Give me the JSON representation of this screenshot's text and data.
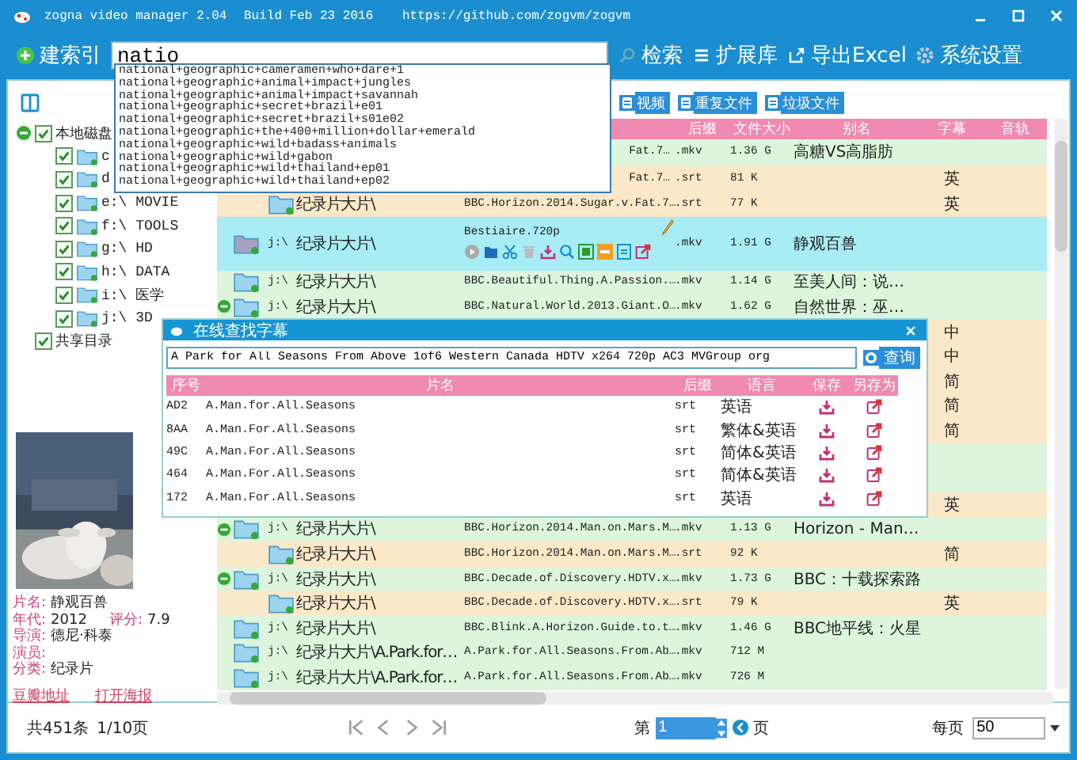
{
  "window": {
    "title": "zogna video manager 2.04",
    "build": "Build Feb 23 2016",
    "url": "https://github.com/zogvm/zogvm"
  },
  "toolbar": {
    "index_button": "建索引",
    "search": {
      "value": "natio"
    },
    "search_button": "检索",
    "library_button": "扩展库",
    "export_button": "导出Excel",
    "settings_button": "系统设置"
  },
  "suggestions": [
    "national+geographic+cameramen+who+dare+1",
    "national+geographic+animal+impact+jungles",
    "national+geographic+animal+impact+savannah",
    "national+geographic+secret+brazil+e01",
    "national+geographic+secret+brazil+s01e02",
    "national+geographic+the+400+million+dollar+emerald",
    "national+geographic+wild+badass+animals",
    "national+geographic+wild+gabon",
    "national+geographic+wild+thailand+ep01",
    "national+geographic+wild+thailand+ep02"
  ],
  "tree": [
    {
      "label": "本地磁盘",
      "checked": true,
      "expanded": true,
      "children": [
        {
          "label": "c",
          "checked": true
        },
        {
          "label": "d",
          "checked": true
        },
        {
          "label": "e:\\ MOVIE",
          "checked": true
        },
        {
          "label": "f:\\ TOOLS",
          "checked": true
        },
        {
          "label": "g:\\ HD",
          "checked": true
        },
        {
          "label": "h:\\ DATA",
          "checked": true
        },
        {
          "label": "i:\\ 医学",
          "checked": true
        },
        {
          "label": "j:\\ 3D",
          "checked": true
        }
      ]
    },
    {
      "label": "共享目录",
      "checked": true,
      "expanded": false
    }
  ],
  "movie_info": {
    "poster": {
      "kind": "picture"
    },
    "lines": [
      [
        {
          "label": "片名:",
          "value": "静观百兽"
        }
      ],
      [
        {
          "label": "年代:",
          "value": "2012"
        },
        {
          "label": "评分:",
          "value": "7.9"
        }
      ],
      [
        {
          "label": "导演:",
          "value": "德尼·科泰"
        }
      ],
      [
        {
          "label": "演员:"
        }
      ],
      [
        {
          "label": "分类:",
          "value": "纪录片"
        }
      ]
    ],
    "links": [
      "豆瓣地址",
      "打开海报"
    ]
  },
  "filter_buttons": [
    "视频",
    "重复文件",
    "垃圾文件"
  ],
  "table": {
    "columns": [
      "后缀",
      "文件大小",
      "别名",
      "字幕",
      "音轨"
    ],
    "rows": [
      {
        "kind": "main",
        "selected": false,
        "expanded": false,
        "file": "Fat.7…",
        "ext": ".mkv",
        "size": "1.36 G",
        "alias": "高糖VS高脂肪"
      },
      {
        "kind": "sub",
        "selected": false,
        "expanded": false,
        "file": "Fat.7…",
        "ext": ".srt",
        "size": "81 K",
        "sub": "英"
      },
      {
        "kind": "sub",
        "selected": false,
        "expanded": false,
        "dir": "纪录片大片\\",
        "file": "BBC.Horizon.2014.Sugar.v.Fat.7…",
        "ext": ".srt",
        "size": "77 K",
        "sub": "英"
      },
      {
        "kind": "main",
        "selected": true,
        "expanded": false,
        "drive": "j:\\",
        "dir": "纪录片大片\\",
        "file": "Bestiaire.720p",
        "ext": ".mkv",
        "size": "1.91 G",
        "alias": "静观百兽"
      },
      {
        "kind": "main",
        "selected": false,
        "expanded": false,
        "drive": "j:\\",
        "dir": "纪录片大片\\",
        "file": "BBC.Beautiful.Thing.A.Passion.…",
        "ext": ".mkv",
        "size": "1.14 G",
        "alias": "至美人间：说…"
      },
      {
        "kind": "main",
        "selected": false,
        "expanded": true,
        "drive": "j:\\",
        "dir": "纪录片大片\\",
        "file": "BBC.Natural.World.2013.Giant.O…",
        "ext": ".mkv",
        "size": "1.62 G",
        "alias": "自然世界：巫…"
      },
      {
        "kind": "sub",
        "selected": false,
        "expanded": false,
        "sub": "中"
      },
      {
        "kind": "sub",
        "selected": false,
        "expanded": false,
        "sub": "中"
      },
      {
        "kind": "sub",
        "selected": false,
        "expanded": false,
        "sub": "简"
      },
      {
        "kind": "sub",
        "selected": false,
        "expanded": false,
        "sub": "简"
      },
      {
        "kind": "sub",
        "selected": false,
        "expanded": false,
        "sub": "简"
      },
      {
        "kind": "main",
        "selected": false,
        "expanded": false
      },
      {
        "kind": "main",
        "selected": false,
        "expanded": false
      },
      {
        "kind": "sub",
        "selected": false,
        "expanded": false,
        "sub": "英"
      },
      {
        "kind": "main",
        "selected": false,
        "expanded": true,
        "drive": "j:\\",
        "dir": "纪录片大片\\",
        "file": "BBC.Horizon.2014.Man.on.Mars.M…",
        "ext": ".mkv",
        "size": "1.13 G",
        "alias": "Horizon - Man…"
      },
      {
        "kind": "sub",
        "selected": false,
        "expanded": false,
        "dir": "纪录片大片\\",
        "file": "BBC.Horizon.2014.Man.on.Mars.M…",
        "ext": ".srt",
        "size": "92 K",
        "sub": "简"
      },
      {
        "kind": "main",
        "selected": false,
        "expanded": true,
        "drive": "j:\\",
        "dir": "纪录片大片\\",
        "file": "BBC.Decade.of.Discovery.HDTV.x…",
        "ext": ".mkv",
        "size": "1.73 G",
        "alias": "BBC：十载探索路"
      },
      {
        "kind": "sub",
        "selected": false,
        "expanded": false,
        "dir": "纪录片大片\\",
        "file": "BBC.Decade.of.Discovery.HDTV.x…",
        "ext": ".srt",
        "size": "79 K",
        "sub": "英"
      },
      {
        "kind": "main",
        "selected": false,
        "expanded": false,
        "drive": "j:\\",
        "dir": "纪录片大片\\",
        "file": "BBC.Blink.A.Horizon.Guide.to.t…",
        "ext": ".mkv",
        "size": "1.46 G",
        "alias": "BBC地平线：火星"
      },
      {
        "kind": "main",
        "selected": false,
        "expanded": false,
        "drive": "j:\\",
        "dir": "纪录片大片\\A.Park.for…",
        "file": "A.Park.for.All.Seasons.From.Ab…",
        "ext": ".mkv",
        "size": "712 M"
      },
      {
        "kind": "main",
        "selected": false,
        "expanded": false,
        "drive": "j:\\",
        "dir": "纪录片大片\\A.Park.for…",
        "file": "A.Park.for.All.Seasons.From.Ab…",
        "ext": ".mkv",
        "size": "726 M"
      }
    ]
  },
  "subtitle_dialog": {
    "title": "在线查找字幕",
    "query": "A Park for All Seasons From Above 1of6 Western Canada HDTV x264 720p AC3 MVGroup org",
    "search_button": "查询",
    "columns": [
      "序号",
      "片名",
      "后缀",
      "语言",
      "保存",
      "另存为"
    ],
    "rows": [
      {
        "id": "AD2",
        "name": "A.Man.for.All.Seasons",
        "ext": "srt",
        "lang": "英语"
      },
      {
        "id": "8AA",
        "name": "A.Man.For.All.Seasons",
        "ext": "srt",
        "lang": "繁体&英语"
      },
      {
        "id": "49C",
        "name": "A.Man.For.All.Seasons",
        "ext": "srt",
        "lang": "简体&英语"
      },
      {
        "id": "464",
        "name": "A.Man.For.All.Seasons",
        "ext": "srt",
        "lang": "简体&英语"
      },
      {
        "id": "172",
        "name": "A.Man.For.All.Seasons",
        "ext": "srt",
        "lang": "英语"
      }
    ]
  },
  "status_bar": {
    "total": "共451条",
    "pages": "1/10页",
    "page_prefix": "第",
    "page_value": "1",
    "page_suffix": "页",
    "per_page_label": "每页",
    "per_page_value": "50"
  }
}
